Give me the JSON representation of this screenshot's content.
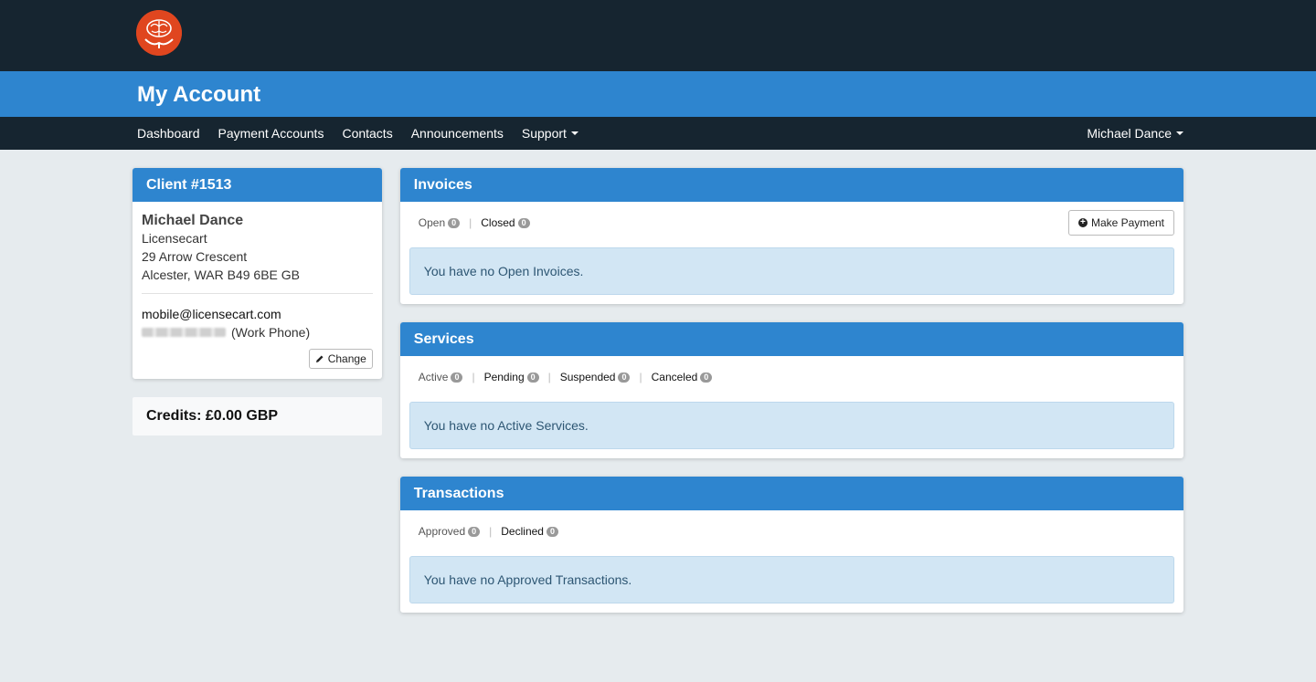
{
  "brand": {
    "logo_icon": "brain-hands-icon",
    "logo_color": "#e0461f"
  },
  "title": "My Account",
  "nav": {
    "items": [
      {
        "label": "Dashboard"
      },
      {
        "label": "Payment Accounts"
      },
      {
        "label": "Contacts"
      },
      {
        "label": "Announcements"
      },
      {
        "label": "Support"
      }
    ],
    "user": "Michael Dance"
  },
  "client": {
    "heading": "Client #1513",
    "name": "Michael Dance",
    "company": "Licensecart",
    "address1": "29 Arrow Crescent",
    "address2": "Alcester, WAR B49 6BE GB",
    "email": "mobile@licensecart.com",
    "phone_label": "(Work Phone)",
    "change_label": "Change"
  },
  "credits": "Credits: £0.00 GBP",
  "invoices": {
    "heading": "Invoices",
    "tabs": [
      {
        "label": "Open",
        "count": "0"
      },
      {
        "label": "Closed",
        "count": "0"
      }
    ],
    "button": "Make Payment",
    "message": "You have no Open Invoices."
  },
  "services": {
    "heading": "Services",
    "tabs": [
      {
        "label": "Active",
        "count": "0"
      },
      {
        "label": "Pending",
        "count": "0"
      },
      {
        "label": "Suspended",
        "count": "0"
      },
      {
        "label": "Canceled",
        "count": "0"
      }
    ],
    "message": "You have no Active Services."
  },
  "transactions": {
    "heading": "Transactions",
    "tabs": [
      {
        "label": "Approved",
        "count": "0"
      },
      {
        "label": "Declined",
        "count": "0"
      }
    ],
    "message": "You have no Approved Transactions."
  },
  "colors": {
    "primary": "#2e85cf",
    "dark": "#162530",
    "background": "#e6ebee",
    "alert": "#d2e6f4"
  }
}
